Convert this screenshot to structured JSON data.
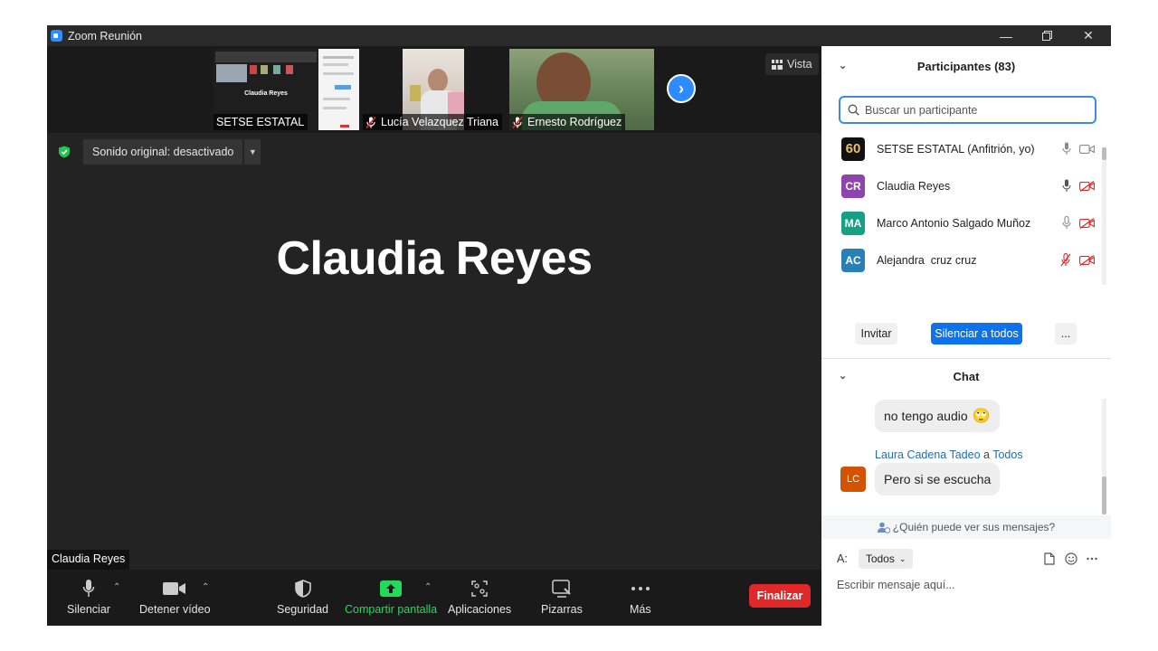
{
  "window": {
    "title": "Zoom Reunión"
  },
  "strip": {
    "thumbs": [
      {
        "name": "SETSE ESTATAL",
        "inner_label": "Claudia Reyes"
      },
      {
        "name": "Lucía Velazquez Triana"
      },
      {
        "name": "Ernesto Rodríguez"
      }
    ],
    "view_label": "Vista"
  },
  "sound": {
    "label": "Sonido original: desactivado"
  },
  "speaker": {
    "name": "Claudia Reyes",
    "tag": "Claudia Reyes"
  },
  "toolbar": {
    "mute": "Silenciar",
    "video": "Detener vídeo",
    "security": "Seguridad",
    "share": "Compartir pantalla",
    "apps": "Aplicaciones",
    "whiteboards": "Pizarras",
    "more": "Más",
    "end": "Finalizar"
  },
  "participants": {
    "title": "Participantes (83)",
    "search_placeholder": "Buscar un participante",
    "items": [
      {
        "initials": "60",
        "name": "SETSE ESTATAL (Anfitrión, yo)",
        "color": "#111111"
      },
      {
        "initials": "CR",
        "name": "Claudia Reyes",
        "color": "#8e44ad"
      },
      {
        "initials": "MA",
        "name": "Marco Antonio Salgado Muñoz",
        "color": "#16a085"
      },
      {
        "initials": "AC",
        "name": "Alejandra  cruz cruz",
        "color": "#2980b9"
      }
    ],
    "invite": "Invitar",
    "mute_all": "Silenciar a todos",
    "more": "..."
  },
  "chat": {
    "title": "Chat",
    "msg1": "no tengo audio",
    "msg1_emoji": "🙄",
    "sender": "Laura Cadena Tadeo",
    "sender_to": "a",
    "sender_target": "Todos",
    "sender_initials": "LC",
    "msg2": "Pero si se escucha",
    "who_sees": "¿Quién puede ver sus mensajes?",
    "to_label": "A:",
    "to_value": "Todos",
    "input_placeholder": "Escribir mensaje aquí..."
  },
  "colors": {
    "accent": "#2d8cff",
    "end_red": "#e02828",
    "share_green": "#23d959",
    "security_green": "#23c552"
  }
}
